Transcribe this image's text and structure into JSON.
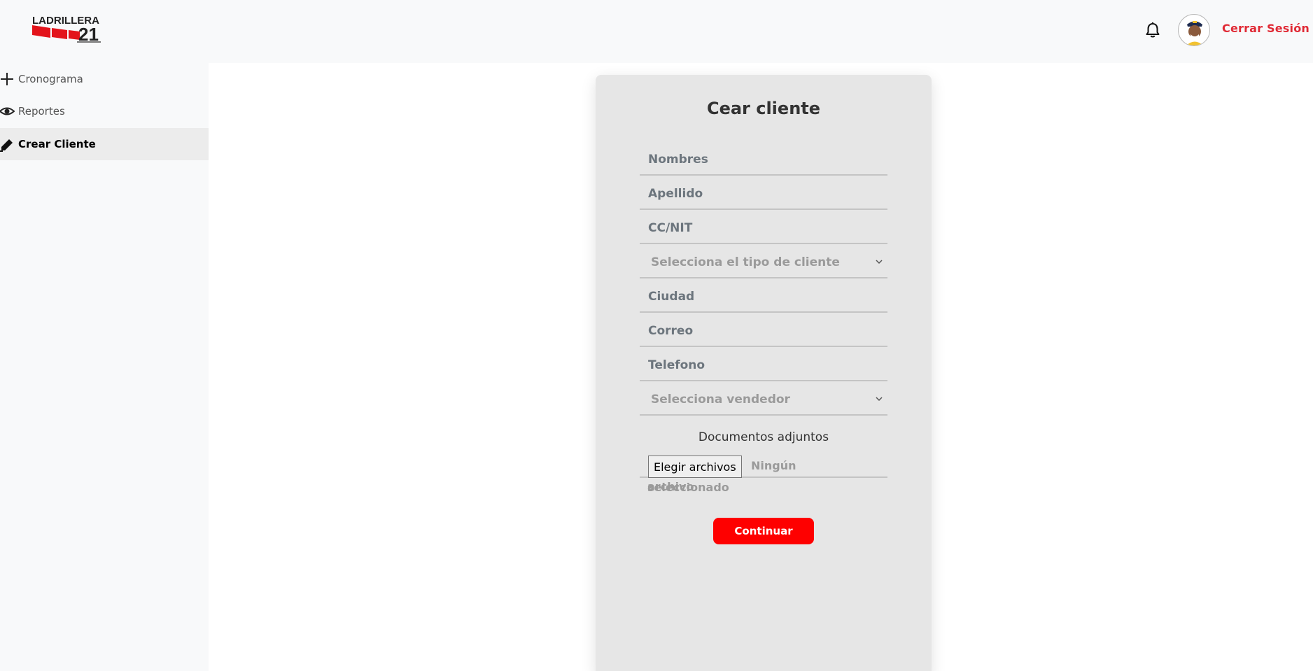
{
  "header": {
    "logo_text": "LADRILLERA",
    "logo_number": "21",
    "logout_label": "Cerrar Sesión"
  },
  "sidebar": {
    "items": [
      {
        "label": "Cronograma",
        "icon": "plus-icon"
      },
      {
        "label": "Reportes",
        "icon": "eye-icon"
      },
      {
        "label": "Crear Cliente",
        "icon": "pencil-icon",
        "active": true
      }
    ]
  },
  "form": {
    "title": "Cear cliente",
    "fields": {
      "nombres": "Nombres",
      "apellido": "Apellido",
      "cc_nit": "CC/NIT",
      "tipo_cliente": "Selecciona el tipo de cliente",
      "ciudad": "Ciudad",
      "correo": "Correo",
      "telefono": "Telefono",
      "vendedor": "Selecciona vendedor"
    },
    "attachments_label": "Documentos adjuntos",
    "file_button": "Elegir archivos",
    "file_status_line1": "Ningún archivo",
    "file_status_line2": "seleccionado",
    "submit_label": "Continuar"
  },
  "colors": {
    "brand_red": "#fe0000",
    "logout_red": "#e02a35",
    "card_bg": "#e6e6e6"
  }
}
